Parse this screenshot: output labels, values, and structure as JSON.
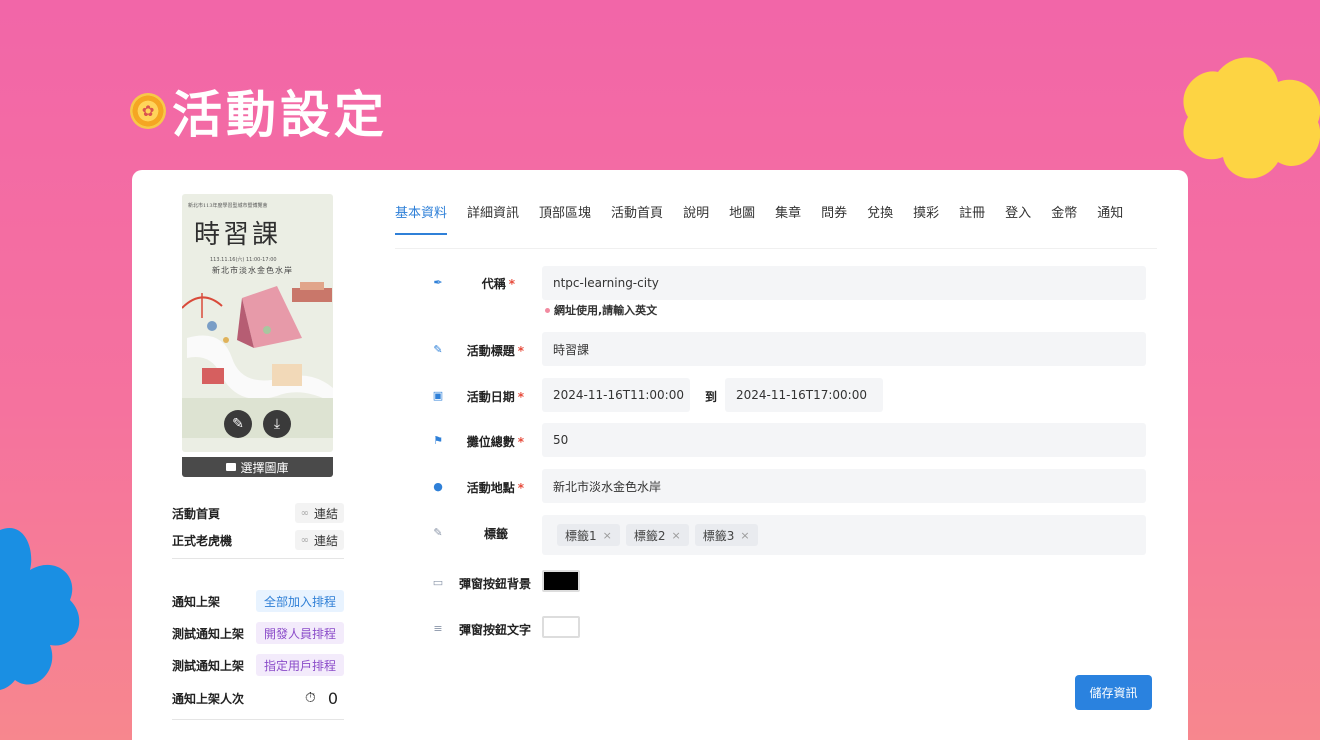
{
  "page": {
    "title": "活動設定",
    "title_icon": "badge-icon"
  },
  "poster": {
    "header_text": "新北市113年度學習型城市暨博覽會",
    "title": "時習課",
    "date_line": "113.11.16(六) 11:00-17:00",
    "place_line": "新北市淡水金色水岸",
    "edit_icon": "pencil-icon",
    "download_icon": "download-icon"
  },
  "sidebar": {
    "choose_gallery_label": "選擇圖庫",
    "links": [
      {
        "label": "活動首頁",
        "action": "連結"
      },
      {
        "label": "正式老虎機",
        "action": "連結"
      }
    ],
    "notify": [
      {
        "label": "通知上架",
        "action": "全部加入排程",
        "color": "#2f7fd6"
      },
      {
        "label": "測試通知上架",
        "action": "開發人員排程",
        "color": "#8b4cc9"
      },
      {
        "label": "測試通知上架",
        "action": "指定用戶排程",
        "color": "#8b4cc9"
      }
    ],
    "notify_count": {
      "label": "通知上架人次",
      "value": "0"
    }
  },
  "tabs": [
    "基本資料",
    "詳細資訊",
    "頂部區塊",
    "活動首頁",
    "說明",
    "地圖",
    "集章",
    "問券",
    "兌換",
    "摸彩",
    "註冊",
    "登入",
    "金幣",
    "通知"
  ],
  "form": {
    "code": {
      "label": "代稱",
      "value": "ntpc-learning-city",
      "hint": "網址使用,請輸入英文"
    },
    "title": {
      "label": "活動標題",
      "value": "時習課"
    },
    "date": {
      "label": "活動日期",
      "start": "2024-11-16T11:00:00",
      "to": "到",
      "end": "2024-11-16T17:00:00"
    },
    "booths": {
      "label": "攤位總數",
      "value": "50"
    },
    "location": {
      "label": "活動地點",
      "value": "新北市淡水金色水岸"
    },
    "tags": {
      "label": "標籤",
      "items": [
        "標籤1",
        "標籤2",
        "標籤3"
      ]
    },
    "popup_bg": {
      "label": "彈窗按鈕背景",
      "color": "#000000"
    },
    "popup_text": {
      "label": "彈窗按鈕文字",
      "color": "#ffffff"
    },
    "save_label": "儲存資訊"
  },
  "colors": {
    "accent": "#2f80d8",
    "background": "#f266a8"
  }
}
